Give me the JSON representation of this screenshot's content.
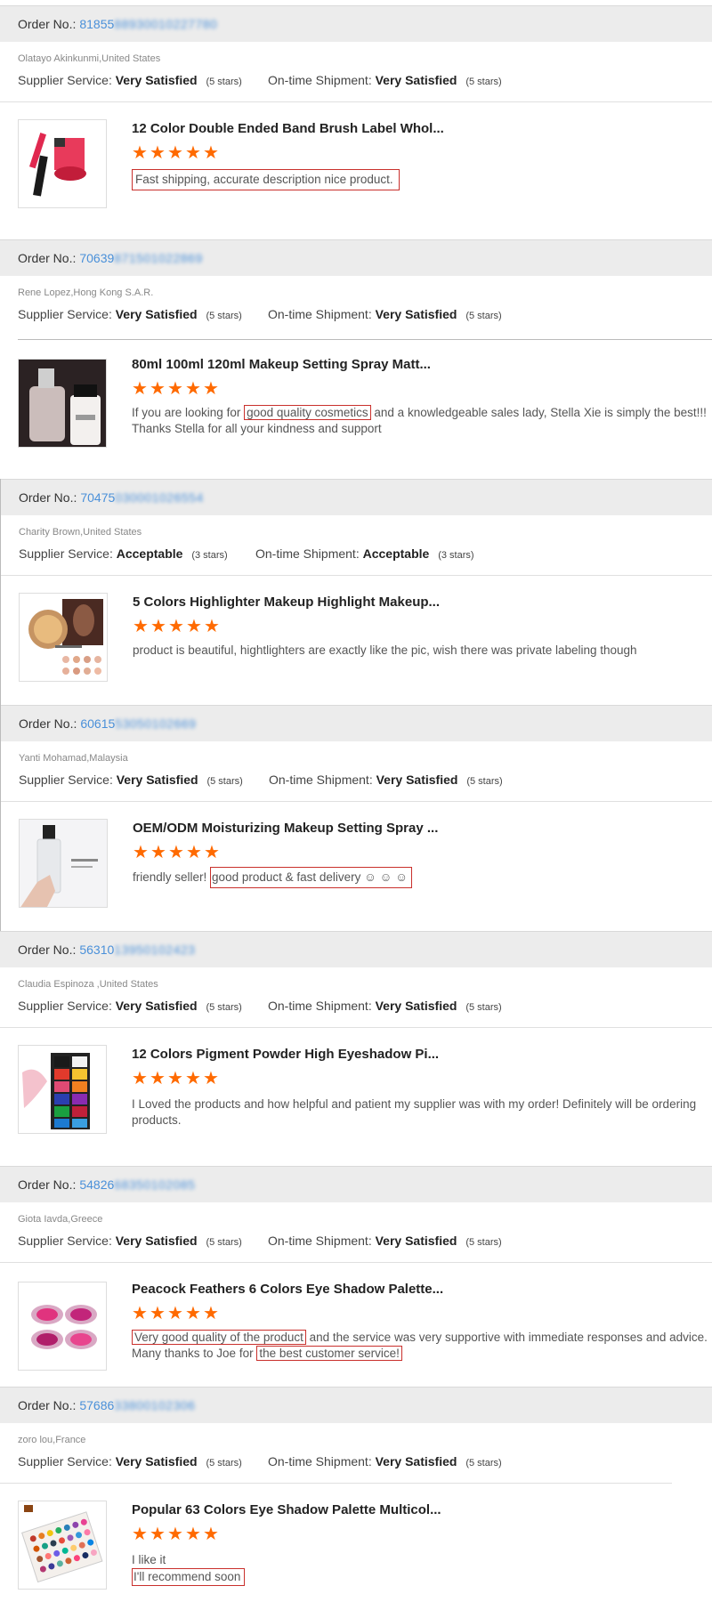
{
  "labels": {
    "order_no": "Order No.:",
    "supplier_service": "Supplier Service:",
    "ontime_shipment": "On-time Shipment:"
  },
  "star_color": "#ff6a00",
  "highlight_color": "#c9302c",
  "link_color": "#4a90d9",
  "reviews": [
    {
      "order_prefix": "81855",
      "order_blurred": "88930010227780",
      "buyer": "Olatayo Akinkunmi,United States",
      "supplier_rating": "Very Satisfied",
      "supplier_stars": "(5 stars)",
      "shipment_rating": "Very Satisfied",
      "shipment_stars": "(5 stars)",
      "product_title": "12 Color Double Ended Band Brush Label Whol...",
      "rating": 5,
      "comment": [
        "Fast shipping, accurate description nice product."
      ]
    },
    {
      "order_prefix": "70639",
      "order_blurred": "871501022869",
      "buyer": "Rene Lopez,Hong Kong S.A.R.",
      "supplier_rating": "Very Satisfied",
      "supplier_stars": "(5 stars)",
      "shipment_rating": "Very Satisfied",
      "shipment_stars": "(5 stars)",
      "product_title": "80ml 100ml 120ml Makeup Setting Spray Matt...",
      "rating": 5,
      "comment": [
        "If you are looking for ",
        "good quality cosmetics",
        " and a knowledgeable sales lady, Stella Xie is simply the best!!! Thanks Stella for all your kindness and support"
      ]
    },
    {
      "order_prefix": "70475",
      "order_blurred": "030001026554",
      "buyer": "Charity Brown,United States",
      "supplier_rating": "Acceptable",
      "supplier_stars": "(3 stars)",
      "shipment_rating": "Acceptable",
      "shipment_stars": "(3 stars)",
      "product_title": "5 Colors Highlighter Makeup Highlight Makeup...",
      "rating": 5,
      "comment": [
        "product is beautiful, hightlighters are exactly like the pic, wish there was private labeling though"
      ]
    },
    {
      "order_prefix": "60615",
      "order_blurred": "53050102669",
      "buyer": "Yanti Mohamad,Malaysia",
      "supplier_rating": "Very Satisfied",
      "supplier_stars": "(5 stars)",
      "shipment_rating": "Very Satisfied",
      "shipment_stars": "(5 stars)",
      "product_title": "OEM/ODM Moisturizing Makeup Setting Spray ...",
      "rating": 5,
      "comment": [
        "friendly seller! ",
        "good product & fast delivery ☺ ☺ ☺"
      ]
    },
    {
      "order_prefix": "56310",
      "order_blurred": "13950102423",
      "buyer": "Claudia Espinoza ,United States",
      "supplier_rating": "Very Satisfied",
      "supplier_stars": "(5 stars)",
      "shipment_rating": "Very Satisfied",
      "shipment_stars": "(5 stars)",
      "product_title": "12 Colors Pigment Powder High Eyeshadow Pi...",
      "rating": 5,
      "comment": [
        "I Loved the products and how helpful and patient my supplier was with my order! Definitely will be ordering products."
      ]
    },
    {
      "order_prefix": "54826",
      "order_blurred": "68350102085",
      "buyer": "Giota Iavda,Greece",
      "supplier_rating": "Very Satisfied",
      "supplier_stars": "(5 stars)",
      "shipment_rating": "Very Satisfied",
      "shipment_stars": "(5 stars)",
      "product_title": "Peacock Feathers 6 Colors Eye Shadow Palette...",
      "rating": 5,
      "comment": [
        "Very good quality of the product",
        " and the service was very supportive with immediate responses and advice. Many thanks to Joe for ",
        "the best customer service! "
      ]
    },
    {
      "order_prefix": "57686",
      "order_blurred": "33800102306",
      "buyer": "zoro lou,France",
      "supplier_rating": "Very Satisfied",
      "supplier_stars": "(5 stars)",
      "shipment_rating": "Very Satisfied",
      "shipment_stars": "(5 stars)",
      "product_title": "Popular 63 Colors Eye Shadow Palette Multicol...",
      "rating": 5,
      "comment": [
        "I like it",
        "I'll recommend soon"
      ]
    }
  ]
}
